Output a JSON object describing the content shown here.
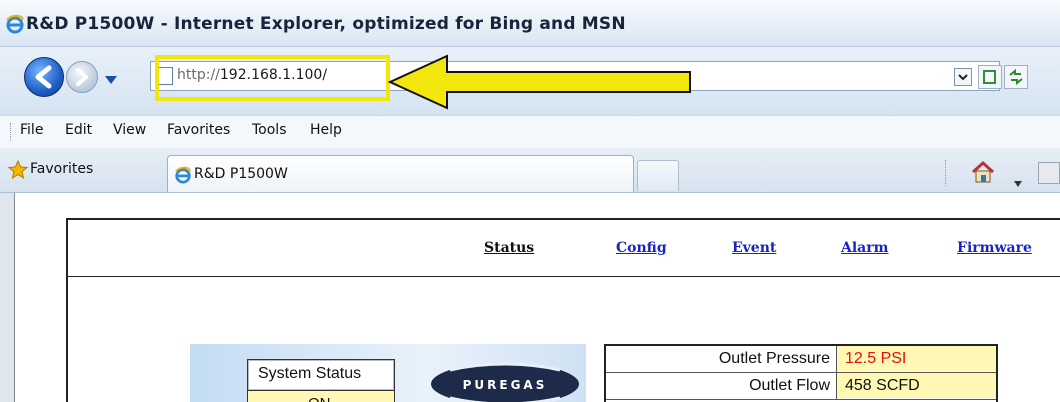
{
  "window": {
    "title": "R&D P1500W - Internet Explorer, optimized for Bing and MSN"
  },
  "address_bar": {
    "protocol": "http://",
    "host": "192.168.1.100/"
  },
  "menu": {
    "items": [
      "File",
      "Edit",
      "View",
      "Favorites",
      "Tools",
      "Help"
    ]
  },
  "favorites_bar": {
    "label": "Favorites"
  },
  "tab": {
    "label": "R&D P1500W"
  },
  "page": {
    "nav": [
      "Status",
      "Config",
      "Event",
      "Alarm",
      "Firmware"
    ],
    "nav_colors": [
      "#111111",
      "#1a23c9",
      "#1a23c9",
      "#1a23c9",
      "#1a23c9"
    ],
    "system_status_label": "System Status",
    "system_status_value": "ON",
    "logo_text": "PUREGAS",
    "readings": [
      {
        "label": "Outlet Pressure",
        "value": "12.5 PSI",
        "color": "#e01010"
      },
      {
        "label": "Outlet Flow",
        "value": "458 SCFD",
        "color": "#111111"
      }
    ]
  },
  "colors": {
    "highlight": "#f3e60c",
    "link": "#1a23c9",
    "value_bg": "#fff8b4"
  }
}
